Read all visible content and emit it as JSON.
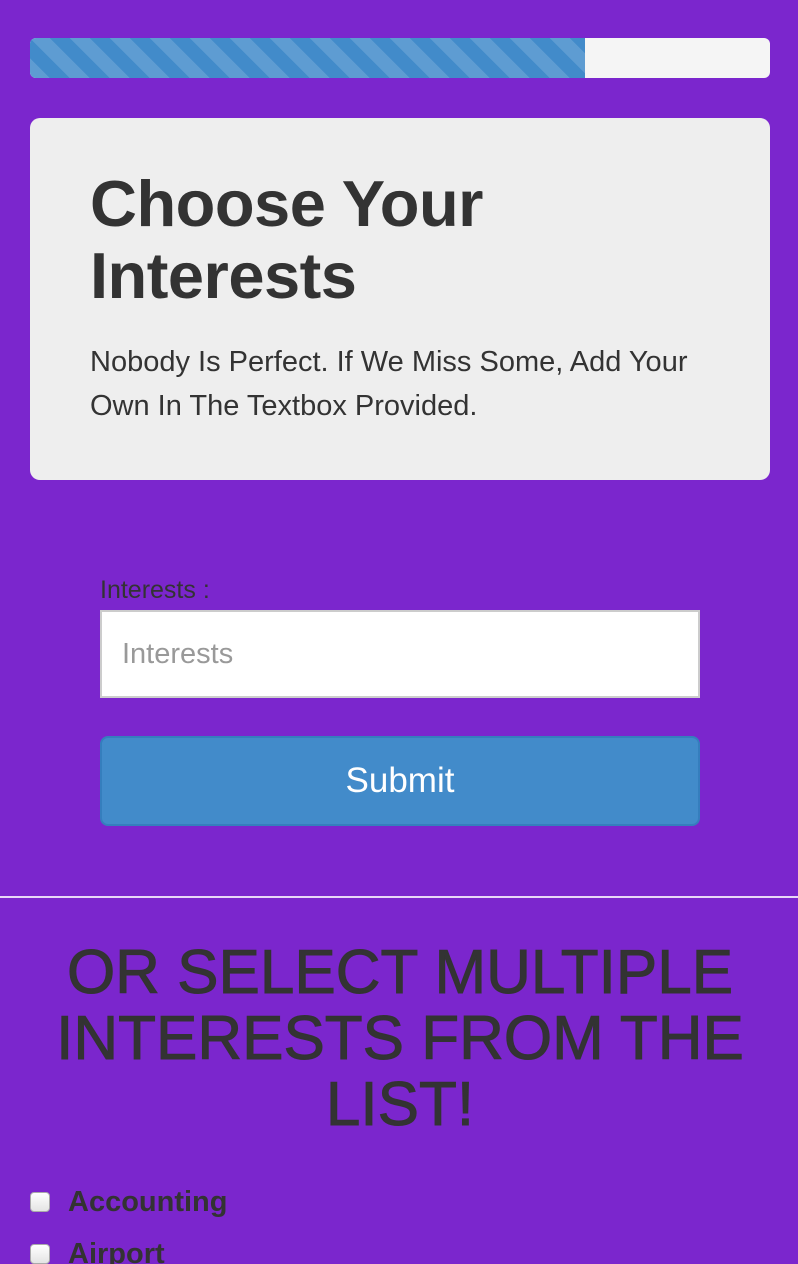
{
  "progress": {
    "percent": 75
  },
  "intro": {
    "title": "Choose Your Interests",
    "subtitle": "Nobody Is Perfect. If We Miss Some, Add Your Own In The Textbox Provided."
  },
  "form": {
    "label": "Interests :",
    "placeholder": "Interests",
    "value": "",
    "submit_label": "Submit"
  },
  "list_section": {
    "heading": "OR SELECT MULTIPLE INTERESTS FROM THE LIST!",
    "items": [
      {
        "label": "Accounting",
        "checked": false
      },
      {
        "label": "Airport",
        "checked": false
      }
    ]
  },
  "colors": {
    "background": "#7b26cd",
    "accent": "#428bca",
    "panel": "#eeeeee",
    "text": "#333333"
  }
}
